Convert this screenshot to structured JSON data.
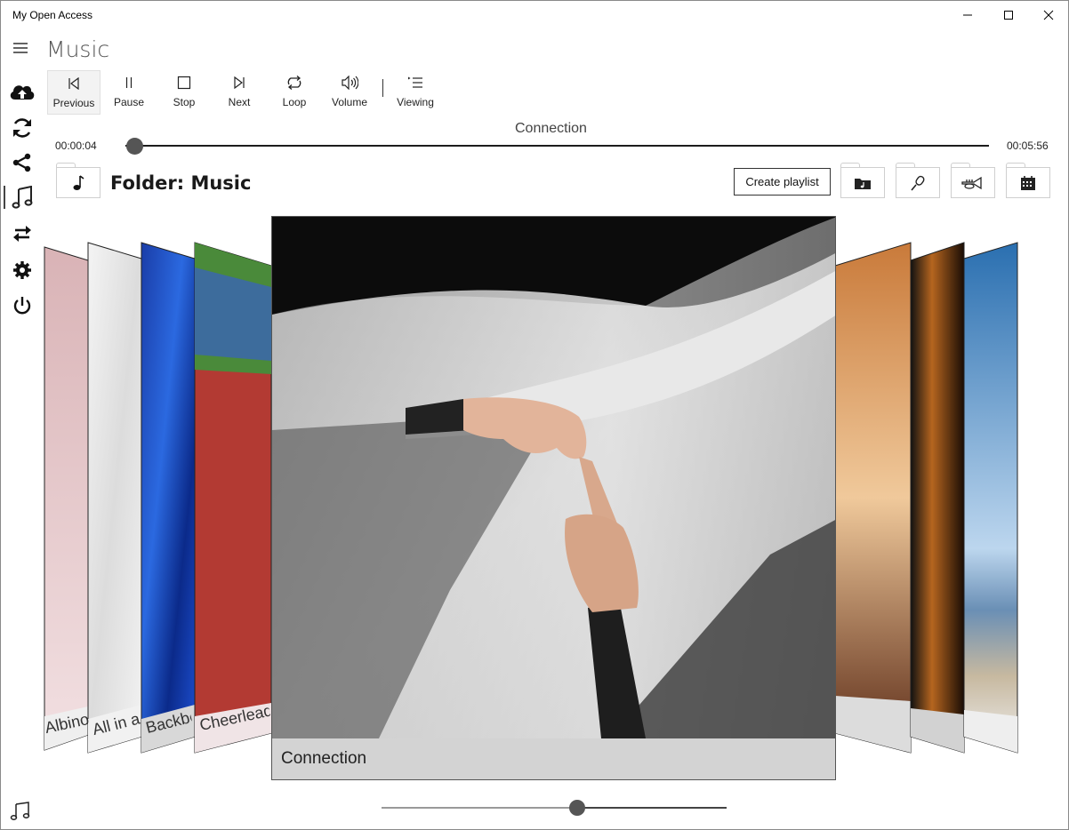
{
  "window": {
    "title": "My Open Access"
  },
  "page": {
    "title": "Music"
  },
  "toolbar": {
    "items": [
      {
        "label": "Previous",
        "icon": "previous-track-icon"
      },
      {
        "label": "Pause",
        "icon": "pause-icon"
      },
      {
        "label": "Stop",
        "icon": "stop-icon"
      },
      {
        "label": "Next",
        "icon": "next-track-icon"
      },
      {
        "label": "Loop",
        "icon": "loop-icon"
      },
      {
        "label": "Volume",
        "icon": "volume-icon"
      },
      {
        "label": "Viewing",
        "icon": "viewing-list-icon"
      }
    ]
  },
  "player": {
    "track_title": "Connection",
    "elapsed": "00:00:04",
    "duration": "00:05:56",
    "progress_fraction": 0.011
  },
  "folder": {
    "label": "Folder: Music",
    "create_playlist_label": "Create playlist"
  },
  "sidebar": {
    "icons": [
      "cloud-upload-icon",
      "sync-icon",
      "share-icon",
      "music-icon",
      "transfer-icon",
      "settings-icon",
      "power-icon"
    ],
    "selected": "music-icon"
  },
  "albums": {
    "left": [
      "Albino",
      "All in a",
      "Backbea",
      "Cheerleader"
    ],
    "center": "Connection",
    "right": [
      "",
      "",
      ""
    ]
  },
  "bottom_slider": {
    "fraction": 0.57
  },
  "colors": {
    "accent": "#333333",
    "caption_bg": "#d3d3d3"
  }
}
